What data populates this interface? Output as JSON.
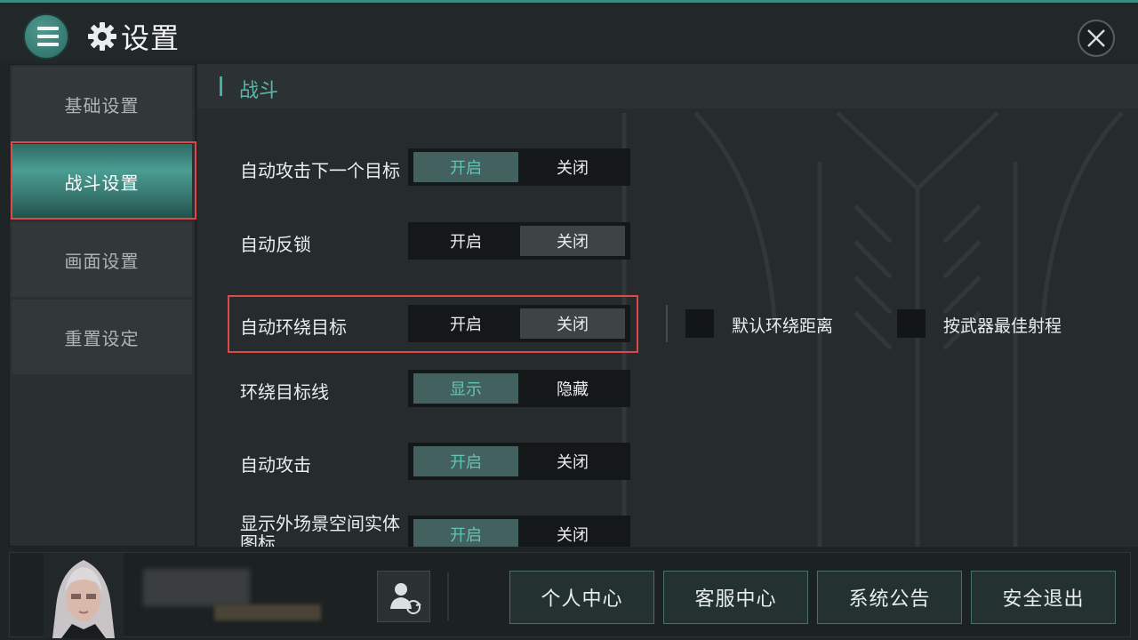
{
  "header": {
    "title": "设置",
    "icons": {
      "menu": "menu-icon",
      "settings": "gear-icon",
      "close": "close-icon"
    }
  },
  "sidebar": {
    "items": [
      {
        "label": "基础设置",
        "active": false
      },
      {
        "label": "战斗设置",
        "active": true
      },
      {
        "label": "画面设置",
        "active": false
      },
      {
        "label": "重置设定",
        "active": false
      }
    ]
  },
  "section": {
    "title": "战斗"
  },
  "settings": [
    {
      "label": "自动攻击下一个目标",
      "left": "开启",
      "right": "关闭",
      "selected": "left"
    },
    {
      "label": "自动反锁",
      "left": "开启",
      "right": "关闭",
      "selected": "right"
    },
    {
      "label": "自动环绕目标",
      "left": "开启",
      "right": "关闭",
      "selected": "right",
      "options": [
        {
          "label": "默认环绕距离",
          "checked": false
        },
        {
          "label": "按武器最佳射程",
          "checked": false
        }
      ]
    },
    {
      "label": "环绕目标线",
      "left": "显示",
      "right": "隐藏",
      "selected": "left"
    },
    {
      "label": "自动攻击",
      "left": "开启",
      "right": "关闭",
      "selected": "left"
    },
    {
      "label": "显示外场景空间实体图标",
      "left": "开启",
      "right": "关闭",
      "selected": "left"
    }
  ],
  "footer": {
    "buttons": [
      "个人中心",
      "客服中心",
      "系统公告",
      "安全退出"
    ],
    "icons": {
      "avatar": "avatar-portrait",
      "switch_account": "switch-account-icon"
    }
  },
  "colors": {
    "accent": "#4a9d92",
    "selected_on": "#43625f",
    "selected_on_text": "#5fc6b6",
    "highlight_border": "#e04848"
  }
}
